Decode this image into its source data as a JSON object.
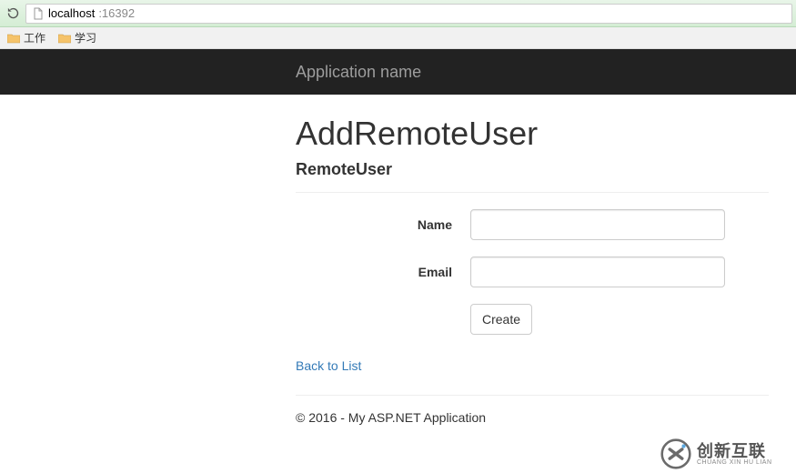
{
  "browser": {
    "url_host": "localhost",
    "url_port": ":16392"
  },
  "bookmarks": [
    {
      "label": "工作"
    },
    {
      "label": "学习"
    }
  ],
  "navbar": {
    "brand": "Application name"
  },
  "page": {
    "title": "AddRemoteUser",
    "subtitle": "RemoteUser"
  },
  "form": {
    "name_label": "Name",
    "name_value": "",
    "email_label": "Email",
    "email_value": "",
    "submit_label": "Create"
  },
  "links": {
    "back": "Back to List"
  },
  "footer": {
    "text": "© 2016 - My ASP.NET Application"
  },
  "watermark": {
    "main": "创新互联",
    "sub": "CHUANG XIN HU LIAN"
  }
}
